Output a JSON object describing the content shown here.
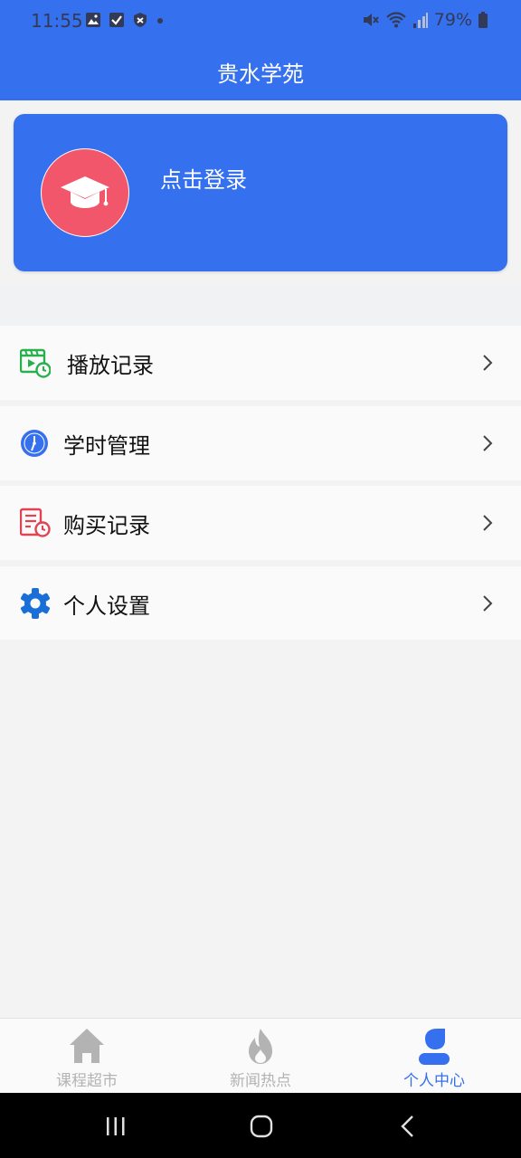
{
  "status": {
    "time": "11:55",
    "battery": "79%"
  },
  "header": {
    "title": "贵水学苑"
  },
  "profile": {
    "login_label": "点击登录"
  },
  "menu": {
    "items": [
      {
        "label": "播放记录",
        "icon": "play-history-icon"
      },
      {
        "label": "学时管理",
        "icon": "clock-icon"
      },
      {
        "label": "购买记录",
        "icon": "purchase-record-icon"
      },
      {
        "label": "个人设置",
        "icon": "gear-icon"
      }
    ]
  },
  "tabs": [
    {
      "label": "课程超市",
      "icon": "home-icon",
      "active": false
    },
    {
      "label": "新闻热点",
      "icon": "flame-icon",
      "active": false
    },
    {
      "label": "个人中心",
      "icon": "person-icon",
      "active": true
    }
  ],
  "colors": {
    "brand": "#3570ee",
    "avatar_bg": "#f2566a",
    "tab_inactive": "#b3b3b3"
  }
}
